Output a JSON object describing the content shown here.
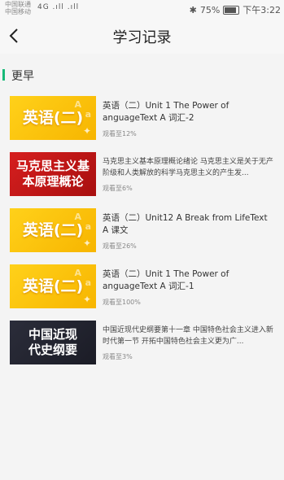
{
  "status_bar": {
    "carrier_line1": "中国联通",
    "carrier_line2": "中国移动",
    "signal_text": "4G .ıll .ıll",
    "battery": "75%",
    "time": "下午3:22"
  },
  "nav": {
    "title": "学习记录",
    "back_icon": "chevron-left-icon"
  },
  "section": {
    "label": "更早",
    "accent_color": "#17b978"
  },
  "items": [
    {
      "thumb_style": "yellow",
      "thumb_text": "英语(二)",
      "title": "英语（二）Unit 1 The Power of anguageText A 词汇-2",
      "progress": "观看至12%"
    },
    {
      "thumb_style": "red",
      "thumb_text": "马克思主义基本原理概论",
      "title": "马克思主义基本原理概论绪论 马克思主义是关于无产阶级和人类解放的科学马克思主义的产生发...",
      "progress": "观看至6%"
    },
    {
      "thumb_style": "yellow",
      "thumb_text": "英语(二)",
      "title": "英语（二）Unit12 A Break from LifeText A  课文",
      "progress": "观看至26%"
    },
    {
      "thumb_style": "yellow",
      "thumb_text": "英语(二)",
      "title": "英语（二）Unit 1 The Power of anguageText A  词汇-1",
      "progress": "观看至100%"
    },
    {
      "thumb_style": "dark",
      "thumb_text": "中国近现代史纲要",
      "title": "中国近现代史纲要第十一章  中国特色社会主义进入新时代第一节  开拓中国特色社会主义更为广...",
      "progress": "观看至3%"
    }
  ]
}
